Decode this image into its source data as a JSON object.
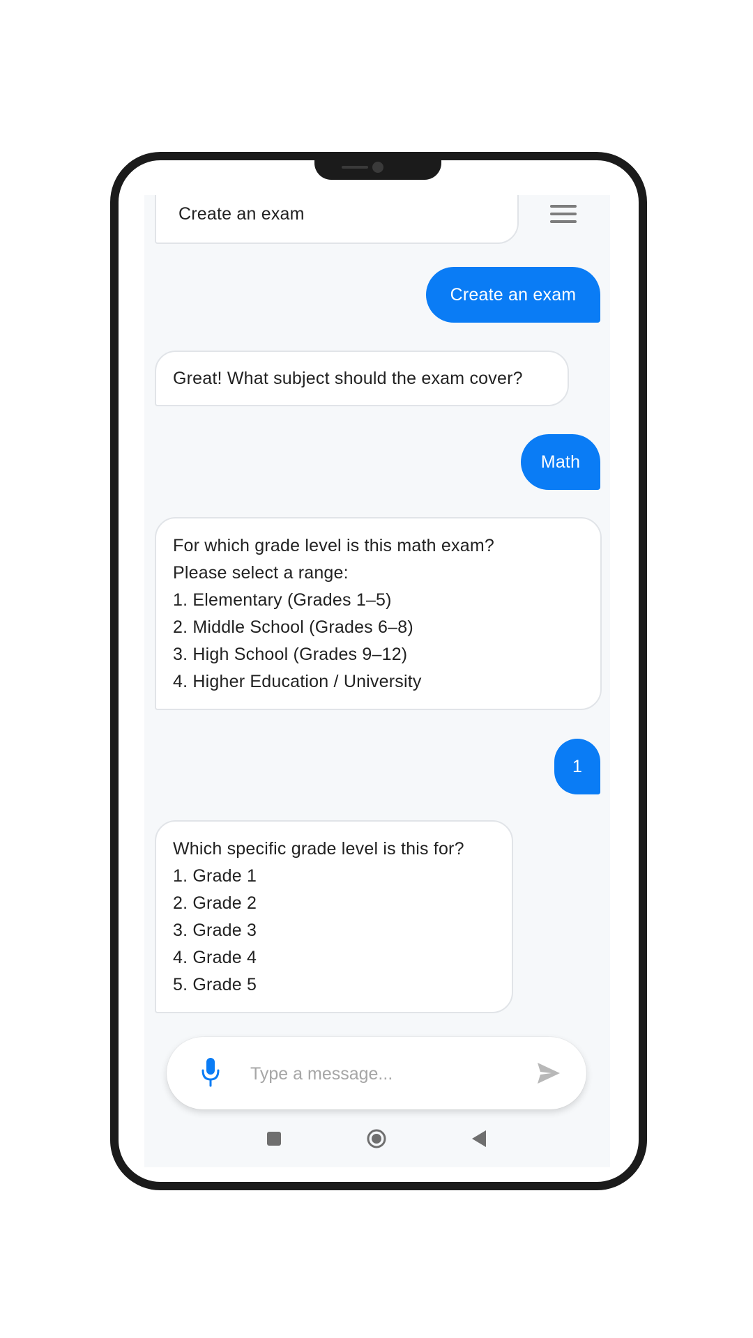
{
  "colors": {
    "accent": "#0a7cf5",
    "bot_bubble": "#ffffff",
    "screen_background": "#f6f8fa"
  },
  "icons": {
    "menu": "hamburger-menu-icon",
    "mic": "microphone-icon",
    "send": "send-icon",
    "nav_recent": "square-icon",
    "nav_home": "circle-home-icon",
    "nav_back": "triangle-back-icon"
  },
  "chat": {
    "messages": [
      {
        "sender": "bot",
        "lines": [
          "Create an exam"
        ]
      },
      {
        "sender": "user",
        "text": "Create an exam"
      },
      {
        "sender": "bot",
        "lines": [
          "Great! What subject should the exam cover?"
        ]
      },
      {
        "sender": "user",
        "text": "Math"
      },
      {
        "sender": "bot",
        "lines": [
          "For which grade level is this math exam?",
          "Please select a range:",
          "1. Elementary (Grades 1–5)",
          "2. Middle School (Grades 6–8)",
          "3. High School (Grades 9–12)",
          "4. Higher Education / University"
        ]
      },
      {
        "sender": "user",
        "text": "1"
      },
      {
        "sender": "bot",
        "lines": [
          "Which specific grade level is this for?",
          "1. Grade 1",
          "2. Grade 2",
          "3. Grade 3",
          "4. Grade 4",
          "5. Grade 5"
        ]
      }
    ]
  },
  "composer": {
    "placeholder": "Type a message..."
  }
}
